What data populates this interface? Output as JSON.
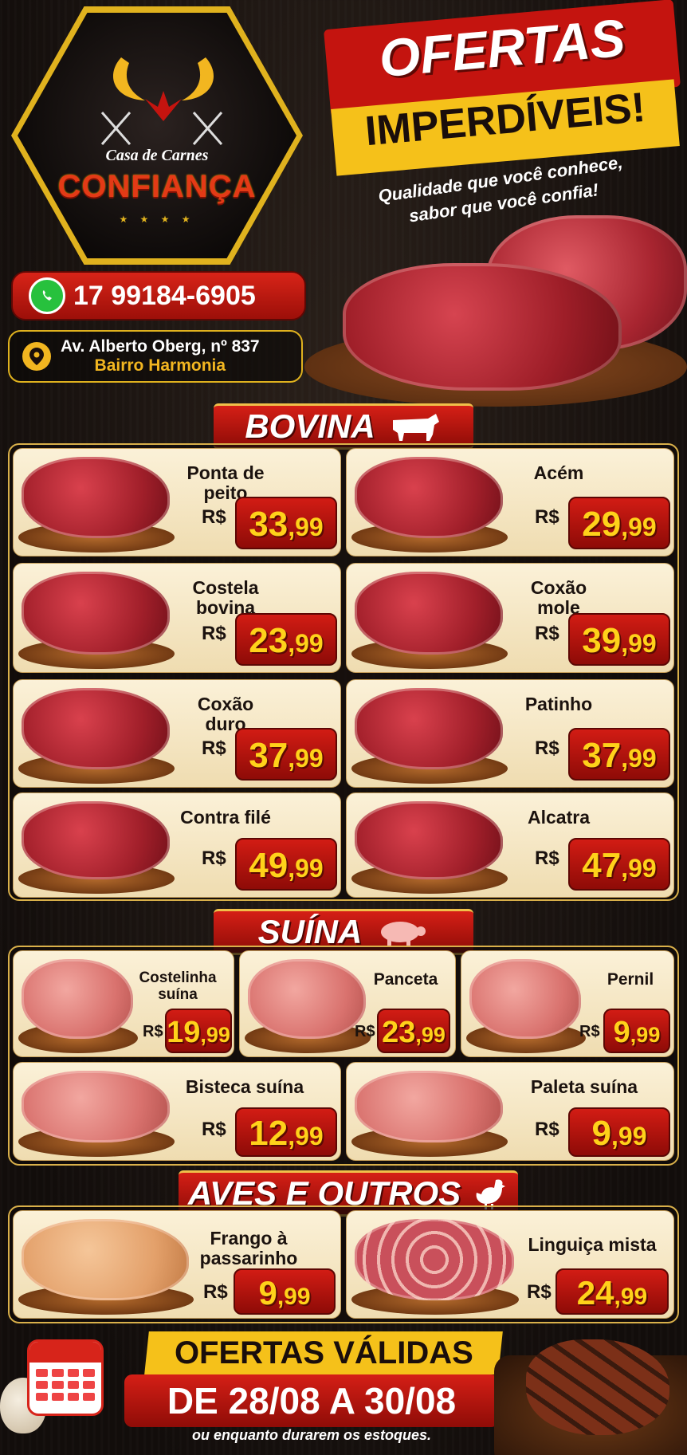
{
  "brand": {
    "small": "Casa de Carnes",
    "name": "CONFIANÇA",
    "stars": "★ ★ ★ ★"
  },
  "contact": {
    "phone": "17 99184-6905",
    "address_line1": "Av. Alberto Oberg, nº 837",
    "address_line2": "Bairro Harmonia"
  },
  "headline": {
    "line1": "OFERTAS",
    "line2": "IMPERDÍVEIS!",
    "slogan1": "Qualidade que você conhece,",
    "slogan2": "sabor que você confia!"
  },
  "currency": "R$",
  "sections": {
    "bovina": {
      "title": "BOVINA",
      "icon": "cow-icon",
      "items": [
        {
          "name": "Ponta de\npeito",
          "int": "33",
          "dec": ",99"
        },
        {
          "name": "Acém",
          "int": "29",
          "dec": ",99"
        },
        {
          "name": "Costela\nbovina",
          "int": "23",
          "dec": ",99"
        },
        {
          "name": "Coxão\nmole",
          "int": "39",
          "dec": ",99"
        },
        {
          "name": "Coxão\nduro",
          "int": "37",
          "dec": ",99"
        },
        {
          "name": "Patinho",
          "int": "37",
          "dec": ",99"
        },
        {
          "name": "Contra filé",
          "int": "49",
          "dec": ",99"
        },
        {
          "name": "Alcatra",
          "int": "47",
          "dec": ",99"
        }
      ]
    },
    "suina": {
      "title": "SUÍNA",
      "icon": "pig-icon",
      "items": [
        {
          "name": "Costelinha suína",
          "int": "19",
          "dec": ",99"
        },
        {
          "name": "Panceta",
          "int": "23",
          "dec": ",99"
        },
        {
          "name": "Pernil",
          "int": "9",
          "dec": ",99"
        },
        {
          "name": "Bisteca suína",
          "int": "12",
          "dec": ",99"
        },
        {
          "name": "Paleta suína",
          "int": "9",
          "dec": ",99"
        }
      ]
    },
    "aves": {
      "title": "AVES E OUTROS",
      "icon": "chicken-icon",
      "items": [
        {
          "name": "Frango à\npassarinho",
          "int": "9",
          "dec": ",99"
        },
        {
          "name": "Linguiça mista",
          "int": "24",
          "dec": ",99"
        }
      ]
    }
  },
  "validity": {
    "title": "OFERTAS VÁLIDAS",
    "dates": "DE 28/08 A 30/08",
    "note": "ou enquanto durarem os estoques."
  },
  "colors": {
    "red": "#c4140f",
    "yellow": "#f5c11a",
    "card": "#fbf1d8",
    "gold_border": "#d9b04a"
  }
}
